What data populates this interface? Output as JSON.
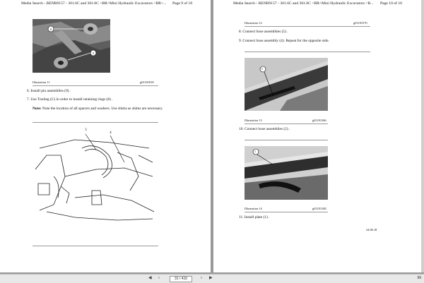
{
  "left_page": {
    "header": "Media Search - RENR9157 - 301.6C and 301.8C <BR>Mini Hydraulic Excavators <BR>...",
    "page_label": "Page 9 of 10",
    "fig1_callouts": [
      "8",
      "9"
    ],
    "fig1_caption": "Illustration 11",
    "fig1_id": "g01181818",
    "step6": "6.  Install pin assemblies (9) .",
    "step7": "7.  Use Tooling (C) in order to install retaining rings (8) .",
    "note_label": "Note:",
    "note_text": " Note the location of all spacers and washers. Use shims as shims are necessary.",
    "fig2_callouts": [
      "3",
      "4"
    ]
  },
  "right_page": {
    "header": "Media Search - RENR9157 - 301.6C and 301.8C <BR>Mini Hydraulic Excavators <B...",
    "page_label": "Page 10 of 10",
    "fig0_caption": "Illustration 12",
    "fig0_id": "g01181570",
    "step8": "8.  Connect hose assemblies (5) .",
    "step9": "9.  Connect hose assembly (4). Repeat for the opposite side.",
    "fig13_callout": "5",
    "fig13_caption": "Illustration 13",
    "fig13_id": "g01181366",
    "step10": "10.  Connect hose assemblies (2) .",
    "fig14_callout": "1",
    "fig14_caption": "Illustration 14",
    "fig14_id": "g01181348",
    "step11": "11.  Install plate (1) .",
    "footer_date": "24.06.18"
  },
  "toolbar": {
    "page_input": "31 / 410",
    "zoom": "99"
  }
}
